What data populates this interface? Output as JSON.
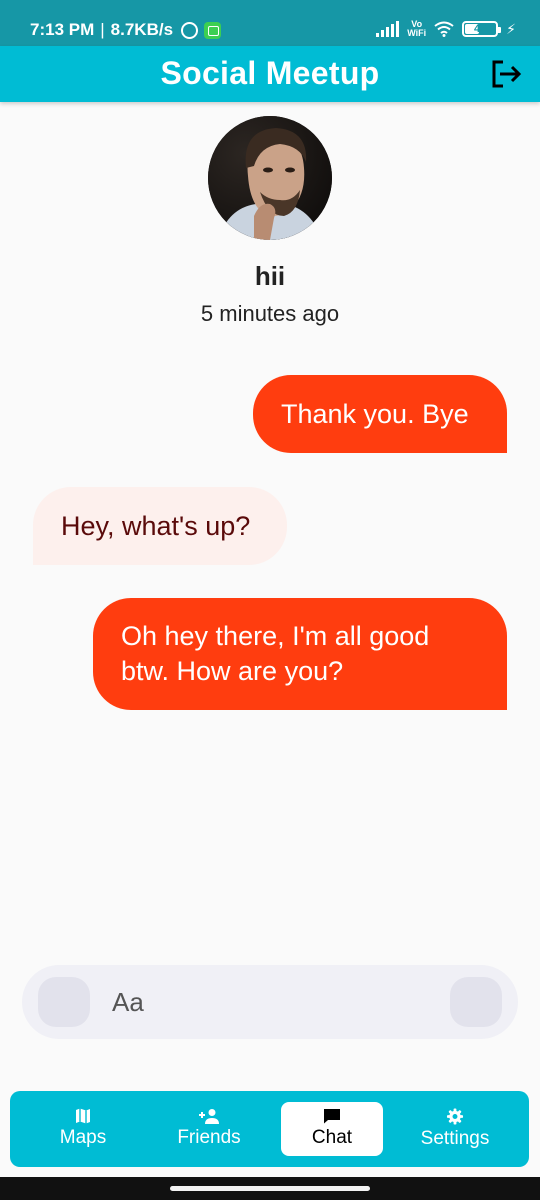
{
  "status_bar": {
    "time": "7:13 PM",
    "speed": "8.7KB/s",
    "volte_top": "Vo",
    "volte_bottom": "WiFi",
    "battery": "42"
  },
  "app_bar": {
    "title": "Social Meetup",
    "logout_icon": "logout-icon"
  },
  "profile": {
    "name": "hii",
    "last_seen": "5 minutes ago"
  },
  "messages": [
    {
      "direction": "outgoing",
      "text": "Thank you. Bye"
    },
    {
      "direction": "incoming",
      "text": "Hey, what's up?"
    },
    {
      "direction": "outgoing",
      "text": "Oh hey there, I'm all good btw. How are you?"
    }
  ],
  "composer": {
    "placeholder": "Aa",
    "value": ""
  },
  "bottom_nav": {
    "items": [
      {
        "label": "Maps",
        "icon": "map-icon",
        "active": false
      },
      {
        "label": "Friends",
        "icon": "add-person-icon",
        "active": false
      },
      {
        "label": "Chat",
        "icon": "chat-icon",
        "active": true
      },
      {
        "label": "Settings",
        "icon": "gear-icon",
        "active": false
      }
    ]
  },
  "colors": {
    "status_bar": "#1697a6",
    "accent": "#00bcd4",
    "outgoing_bubble": "#ff3d0f",
    "incoming_bubble": "#fdf0ed",
    "incoming_text": "#5a0a0a"
  }
}
